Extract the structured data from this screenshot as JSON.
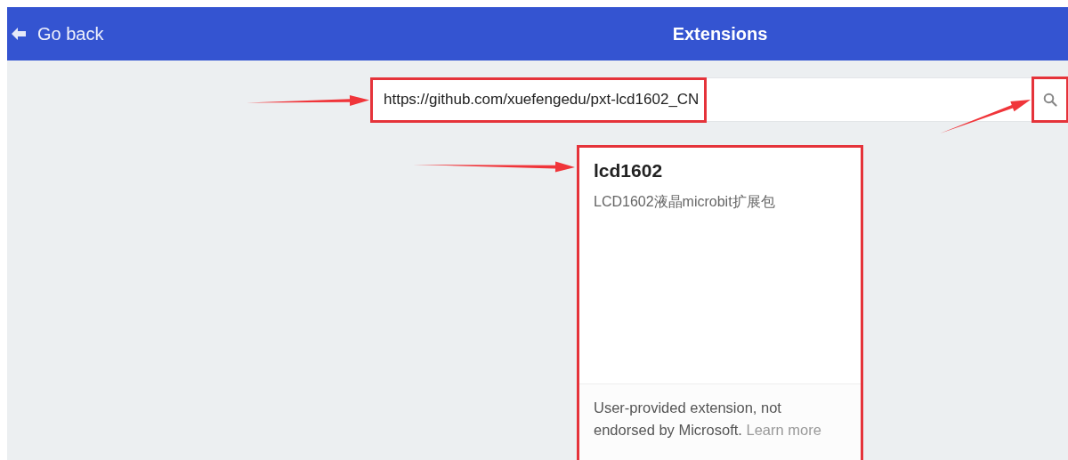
{
  "header": {
    "back_label": "Go back",
    "title": "Extensions"
  },
  "search": {
    "value": "https://github.com/xuefengedu/pxt-lcd1602_CN",
    "highlighted": true
  },
  "search_button": {
    "highlighted": true
  },
  "cards": [
    {
      "name": "lcd1602",
      "description": "LCD1602液晶microbit扩展包",
      "note": "User-provided extension, not endorsed by Microsoft.",
      "link": "Learn more",
      "highlighted": true
    }
  ]
}
